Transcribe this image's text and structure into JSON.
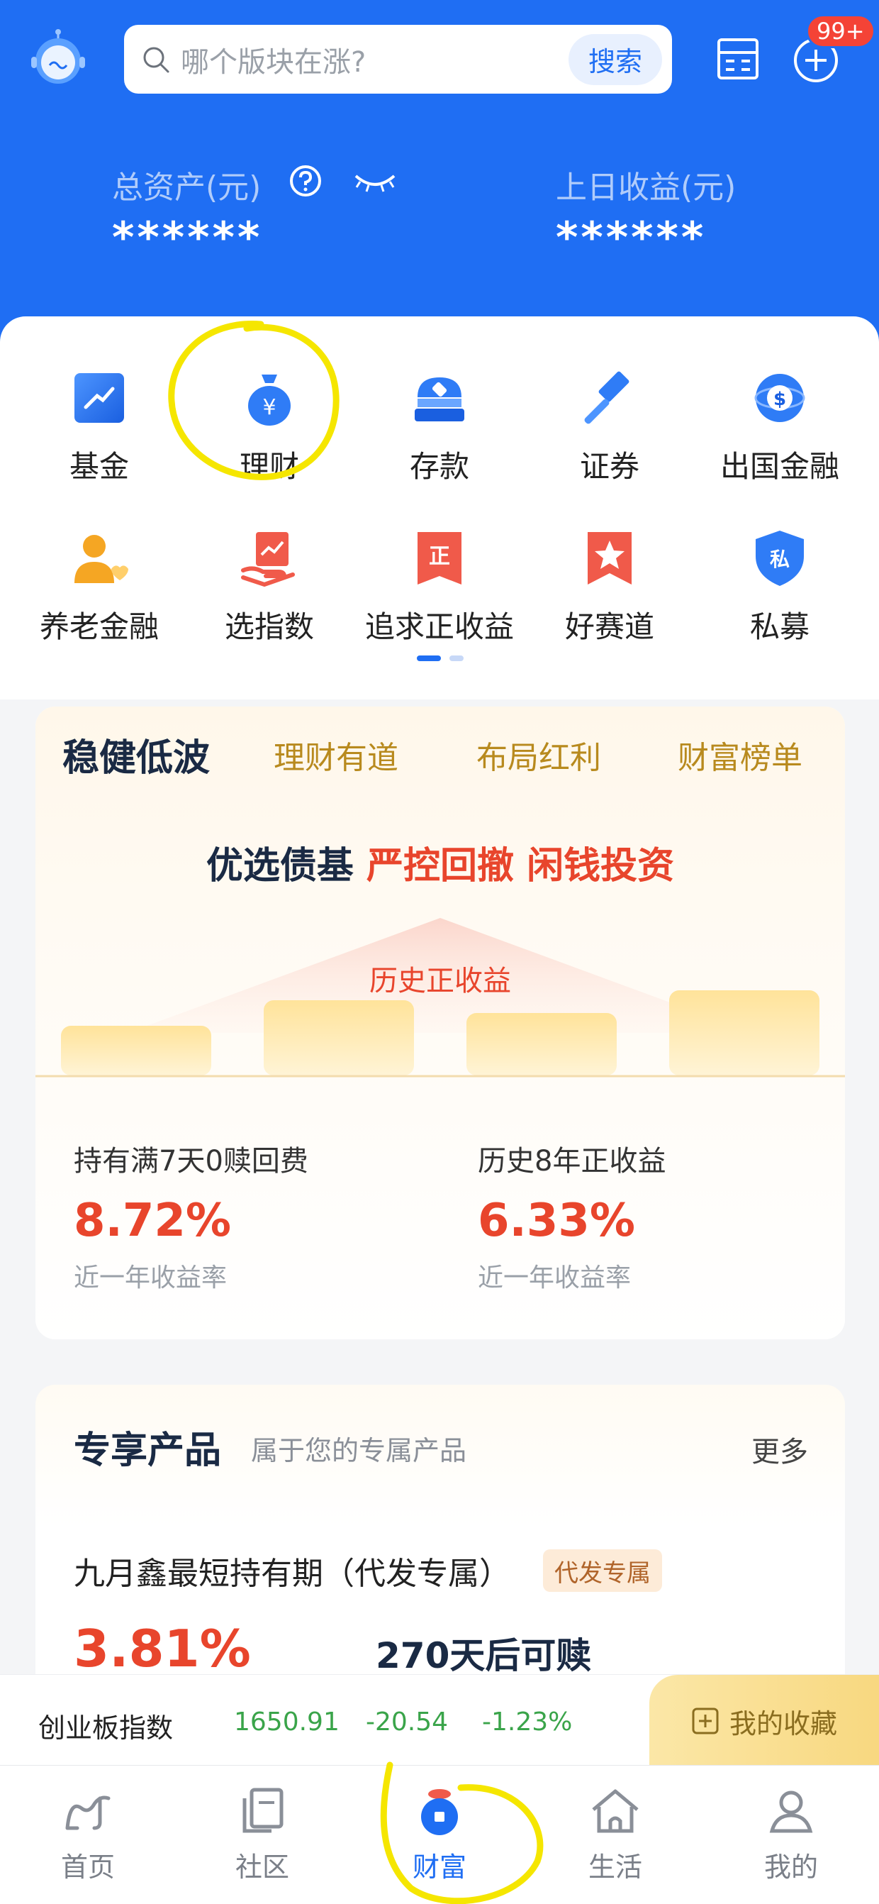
{
  "header": {
    "search_placeholder": "哪个版块在涨?",
    "search_button": "搜索",
    "notification_badge": "99+",
    "total_assets_label": "总资产(元)",
    "total_assets_value": "******",
    "yesterday_income_label": "上日收益(元)",
    "yesterday_income_value": "******"
  },
  "menu": {
    "row1": [
      {
        "label": "基金",
        "icon": "fund-icon"
      },
      {
        "label": "理财",
        "icon": "money-bag-icon"
      },
      {
        "label": "存款",
        "icon": "deposit-icon"
      },
      {
        "label": "证券",
        "icon": "gavel-icon"
      },
      {
        "label": "出国金融",
        "icon": "globe-dollar-icon"
      }
    ],
    "row2": [
      {
        "label": "养老金融",
        "icon": "person-heart-icon"
      },
      {
        "label": "选指数",
        "icon": "hand-chart-icon"
      },
      {
        "label": "追求正收益",
        "icon": "zheng-tag-icon"
      },
      {
        "label": "好赛道",
        "icon": "star-ribbon-icon"
      },
      {
        "label": "私募",
        "icon": "shield-si-icon"
      }
    ]
  },
  "promo": {
    "tabs": [
      "稳健低波",
      "理财有道",
      "布局红利",
      "财富榜单"
    ],
    "headline_dark": "优选债基",
    "headline_red": "严控回撤 闲钱投资",
    "podium_label": "历史正收益",
    "stats": [
      {
        "title": "持有满7天0赎回费",
        "value": "8.72%",
        "sub": "近一年收益率"
      },
      {
        "title": "历史8年正收益",
        "value": "6.33%",
        "sub": "近一年收益率"
      }
    ]
  },
  "exclusive": {
    "title": "专享产品",
    "subtitle": "属于您的专属产品",
    "more": "更多",
    "product_name": "九月鑫最短持有期（代发专属）",
    "product_tag": "代发专属",
    "product_rate": "3.81%",
    "product_redeem": "270天后可赎"
  },
  "ticker": {
    "name": "创业板指数",
    "price": "1650.91",
    "change": "-20.54",
    "percent": "-1.23%",
    "favorites": "我的收藏"
  },
  "nav": [
    {
      "label": "首页",
      "icon": "home-icon"
    },
    {
      "label": "社区",
      "icon": "community-icon"
    },
    {
      "label": "财富",
      "icon": "wealth-icon"
    },
    {
      "label": "生活",
      "icon": "life-icon"
    },
    {
      "label": "我的",
      "icon": "profile-icon"
    }
  ],
  "colors": {
    "brand_blue": "#1f6ef3",
    "accent_red": "#e8452c",
    "gold": "#b88a1e",
    "annotation_yellow": "#f5e600"
  }
}
